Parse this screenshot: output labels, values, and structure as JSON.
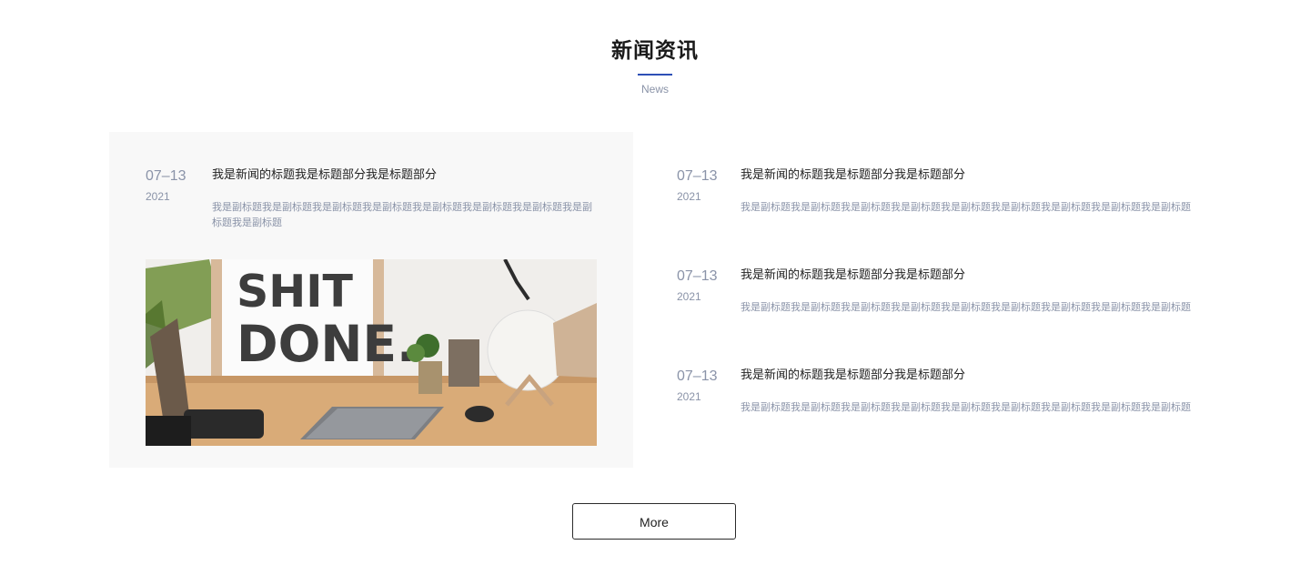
{
  "section": {
    "title": "新闻资讯",
    "subtitle": "News"
  },
  "featured": {
    "day": "07–13",
    "year": "2021",
    "title": "我是新闻的标题我是标题部分我是标题部分",
    "summary": "我是副标题我是副标题我是副标题我是副标题我是副标题我是副标题我是副标题我是副标题我是副标题",
    "image_text": [
      "SHIT",
      "DONE."
    ]
  },
  "news": [
    {
      "day": "07–13",
      "year": "2021",
      "title": "我是新闻的标题我是标题部分我是标题部分",
      "summary": "我是副标题我是副标题我是副标题我是副标题我是副标题我是副标题我是副标题我是副标题我是副标题"
    },
    {
      "day": "07–13",
      "year": "2021",
      "title": "我是新闻的标题我是标题部分我是标题部分",
      "summary": "我是副标题我是副标题我是副标题我是副标题我是副标题我是副标题我是副标题我是副标题我是副标题"
    },
    {
      "day": "07–13",
      "year": "2021",
      "title": "我是新闻的标题我是标题部分我是标题部分",
      "summary": "我是副标题我是副标题我是副标题我是副标题我是副标题我是副标题我是副标题我是副标题我是副标题"
    }
  ],
  "more_button": {
    "label": "More"
  },
  "colors": {
    "accent": "#2d4fb6",
    "muted_text": "#8a93a8",
    "card_background": "#f8f8f8"
  }
}
